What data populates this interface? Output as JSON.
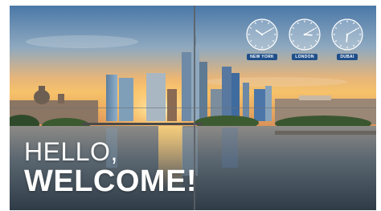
{
  "greeting": {
    "line1": "HELLO,",
    "line2": "WELCOME!"
  },
  "clocks": [
    {
      "city": "NEW YORK",
      "hour": 10,
      "minute": 10
    },
    {
      "city": "LONDON",
      "hour": 3,
      "minute": 10
    },
    {
      "city": "DUBAI",
      "hour": 6,
      "minute": 10
    }
  ],
  "colors": {
    "label_bg": "#1f4f8a",
    "text": "#ffffff"
  }
}
